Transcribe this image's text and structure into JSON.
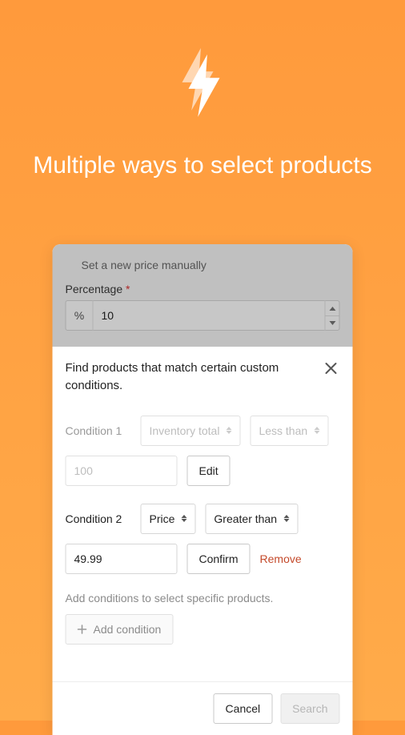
{
  "hero": {
    "title": "Multiple ways to select products"
  },
  "background_panel": {
    "set_price_label": "Set a new price manually",
    "percentage_label": "Percentage",
    "percentage_prefix": "%",
    "percentage_value": "10"
  },
  "sheet": {
    "title": "Find products that match certain custom conditions.",
    "condition1": {
      "label": "Condition 1",
      "field": "Inventory total",
      "operator": "Less than",
      "value": "100",
      "action": "Edit"
    },
    "condition2": {
      "label": "Condition 2",
      "field": "Price",
      "operator": "Greater than",
      "value": "49.99",
      "action": "Confirm",
      "remove": "Remove"
    },
    "hint": "Add conditions to select specific products.",
    "add_condition": "Add condition",
    "footer": {
      "cancel": "Cancel",
      "search": "Search"
    }
  }
}
